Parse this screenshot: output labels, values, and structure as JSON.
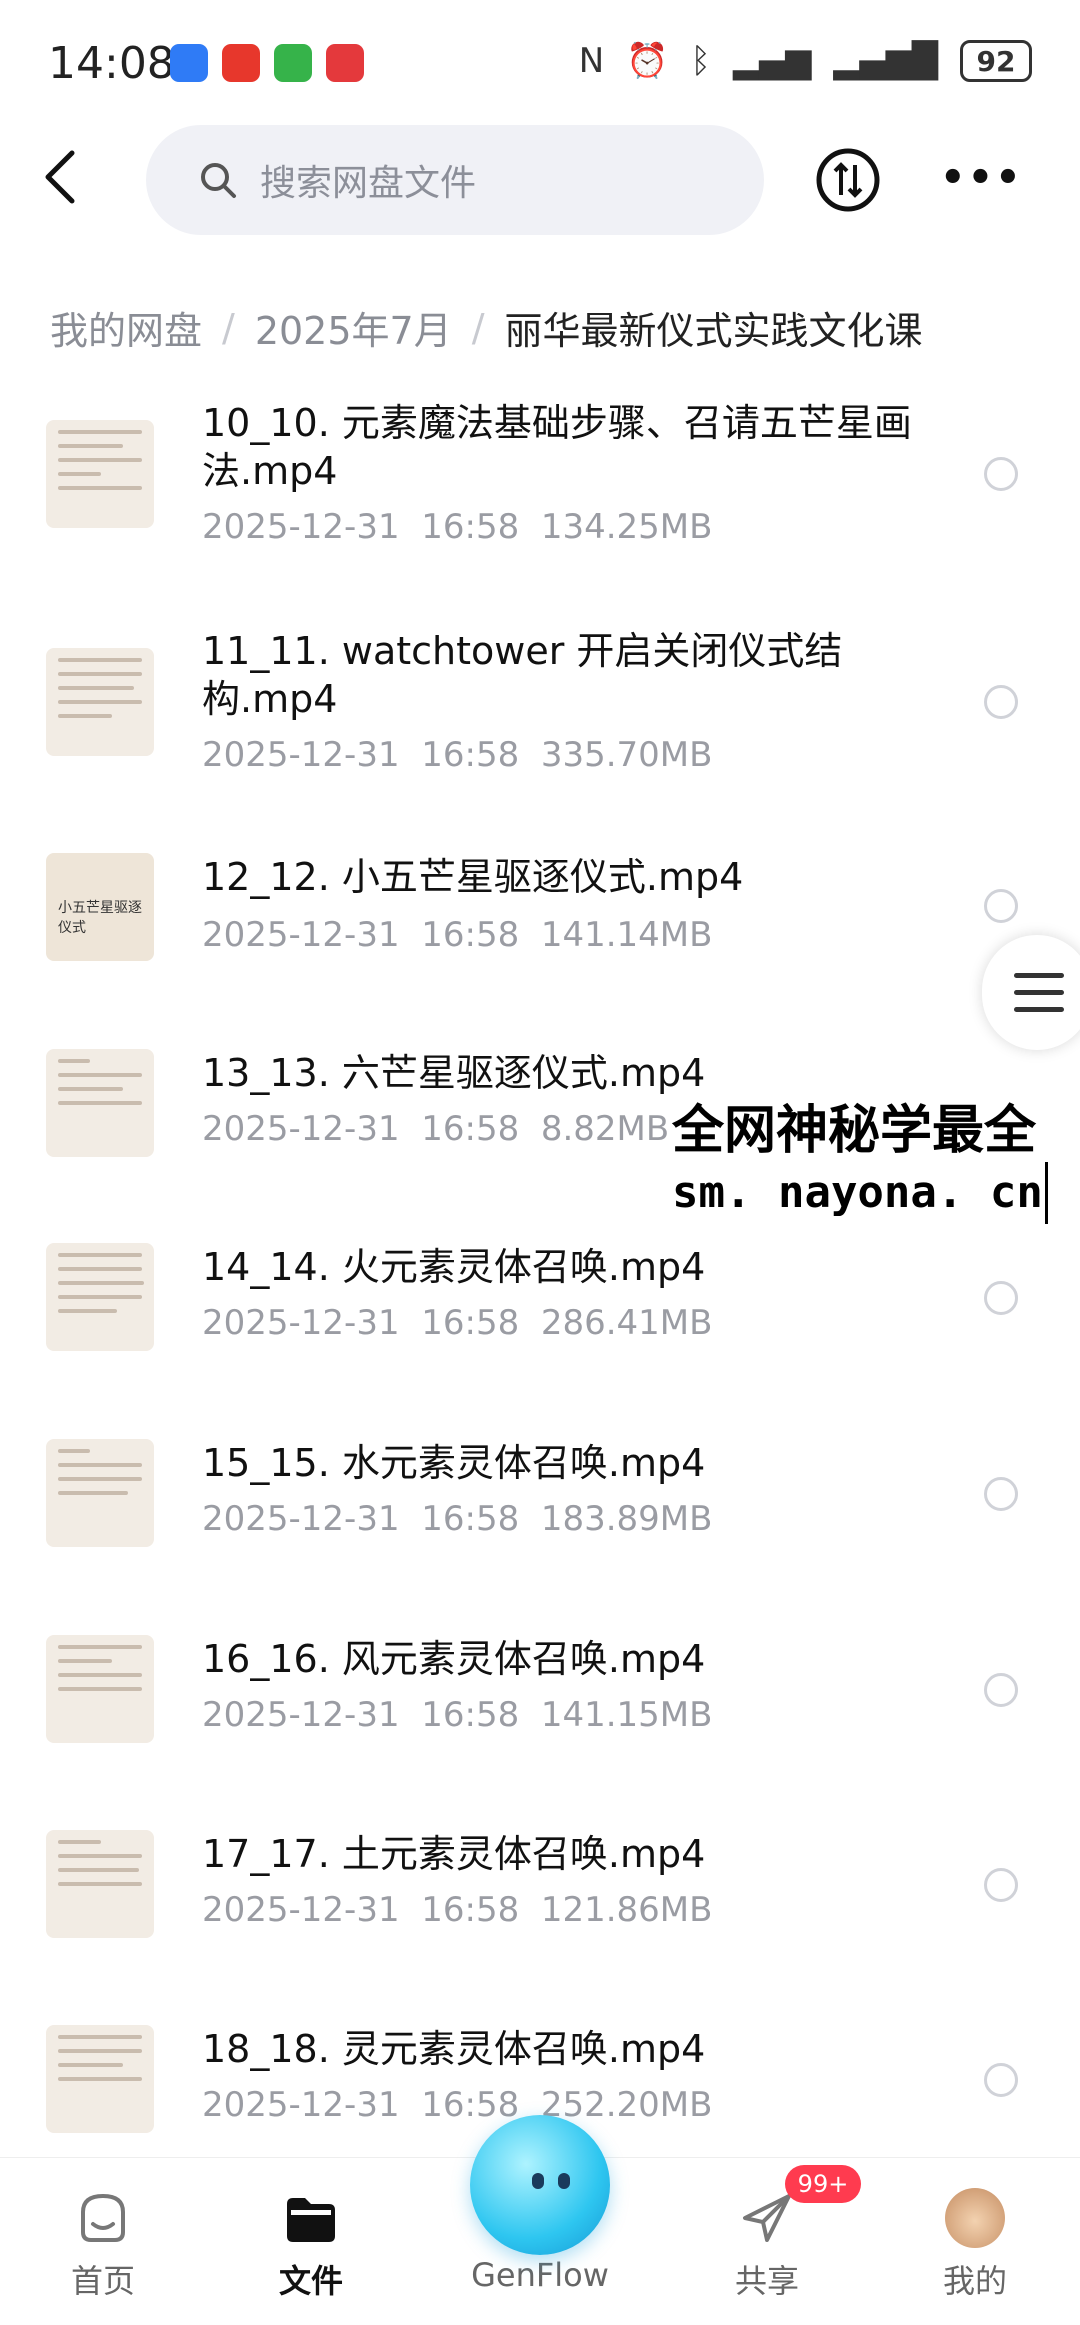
{
  "status_bar": {
    "time": "14:08",
    "battery": "92",
    "app_icons": [
      "#2f7bf6",
      "#e7372c",
      "#36b34a",
      "#e4393c"
    ]
  },
  "search": {
    "placeholder": "搜索网盘文件"
  },
  "breadcrumb": {
    "items": [
      "我的网盘",
      "2025年7月",
      "丽华最新仪式实践文化课"
    ],
    "separator": "/"
  },
  "files": [
    {
      "name": "10_10. 元素魔法基础步骤、召请五芒星画法.mp4",
      "date": "2025-12-31",
      "time": "16:58",
      "size": "134.25MB"
    },
    {
      "name": "11_11. watchtower 开启关闭仪式结构.mp4",
      "date": "2025-12-31",
      "time": "16:58",
      "size": "335.70MB"
    },
    {
      "name": "12_12. 小五芒星驱逐仪式.mp4",
      "date": "2025-12-31",
      "time": "16:58",
      "size": "141.14MB",
      "thumb_text": "小五芒星驱逐仪式"
    },
    {
      "name": "13_13. 六芒星驱逐仪式.mp4",
      "date": "2025-12-31",
      "time": "16:58",
      "size": "8.82MB"
    },
    {
      "name": "14_14. 火元素灵体召唤.mp4",
      "date": "2025-12-31",
      "time": "16:58",
      "size": "286.41MB"
    },
    {
      "name": "15_15. 水元素灵体召唤.mp4",
      "date": "2025-12-31",
      "time": "16:58",
      "size": "183.89MB"
    },
    {
      "name": "16_16. 风元素灵体召唤.mp4",
      "date": "2025-12-31",
      "time": "16:58",
      "size": "141.15MB"
    },
    {
      "name": "17_17. 土元素灵体召唤.mp4",
      "date": "2025-12-31",
      "time": "16:58",
      "size": "121.86MB"
    },
    {
      "name": "18_18. 灵元素灵体召唤.mp4",
      "date": "2025-12-31",
      "time": "16:58",
      "size": "252.20MB"
    }
  ],
  "overlay": {
    "line1": "全网神秘学最全",
    "line2": "sm. nayona. cn"
  },
  "tabbar": {
    "tabs": [
      "首页",
      "文件",
      "GenFlow",
      "共享",
      "我的"
    ],
    "active": "文件",
    "share_badge": "99+"
  },
  "colors": {
    "accent": "#111111",
    "badge": "#ff3b4f",
    "genflow": "#2ec6f0"
  }
}
